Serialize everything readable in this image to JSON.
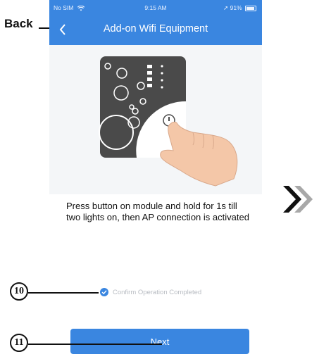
{
  "status_bar": {
    "carrier": "No SIM",
    "time": "9:15 AM",
    "battery": "91%"
  },
  "header": {
    "title": "Add-on Wifi Equipment"
  },
  "instructions": "Press button on module and hold for 1s till two lights on, then AP connection is activated",
  "confirm": {
    "label": "Confirm Operation Completed",
    "checked": true
  },
  "next_label": "Next",
  "annotations": {
    "back": "Back",
    "step_confirm": "10",
    "step_next": "11"
  },
  "colors": {
    "accent": "#3a86e0",
    "device": "#4a4a4a",
    "hand": "#f4c7a8"
  }
}
